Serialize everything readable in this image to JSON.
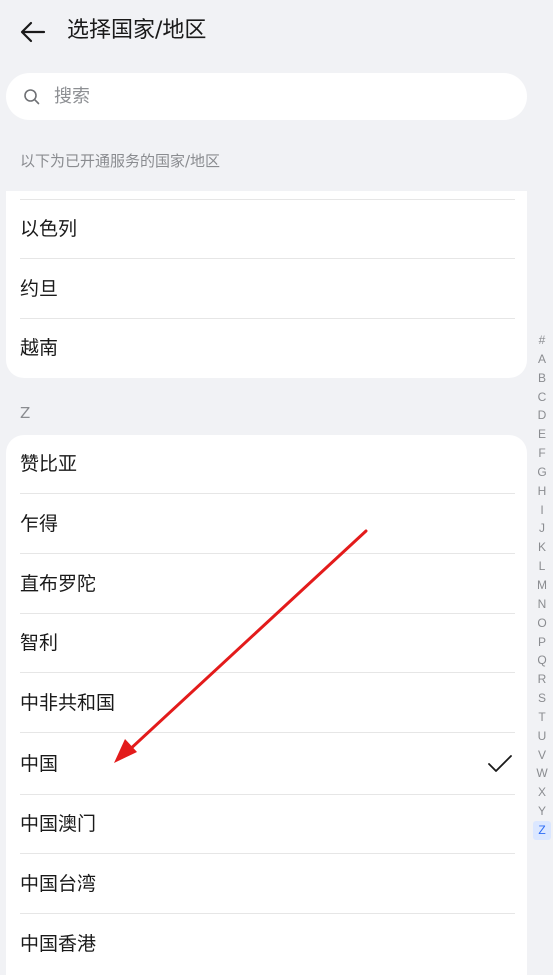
{
  "header": {
    "title": "选择国家/地区"
  },
  "search": {
    "placeholder": "搜索"
  },
  "sections": {
    "opened_caption": "以下为已开通服务的国家/地区",
    "z_caption": "Z"
  },
  "top_card": {
    "items": [
      "以色列",
      "约旦",
      "越南"
    ]
  },
  "z_card": {
    "items": [
      "赞比亚",
      "乍得",
      "直布罗陀",
      "智利",
      "中非共和国",
      "中国",
      "中国澳门",
      "中国台湾",
      "中国香港"
    ],
    "selected": "中国"
  },
  "index_bar": {
    "letters": [
      "#",
      "A",
      "B",
      "C",
      "D",
      "E",
      "F",
      "G",
      "H",
      "I",
      "J",
      "K",
      "L",
      "M",
      "N",
      "O",
      "P",
      "Q",
      "R",
      "S",
      "T",
      "U",
      "V",
      "W",
      "X",
      "Y",
      "Z"
    ],
    "active": "Z"
  },
  "colors": {
    "background": "#f1f2f5",
    "card": "#ffffff",
    "accent": "#2d6cf5",
    "annotation_arrow": "#e31b1b"
  },
  "icons": {
    "back": "arrow-left-icon",
    "search": "magnifier-icon",
    "selected": "check-icon"
  }
}
